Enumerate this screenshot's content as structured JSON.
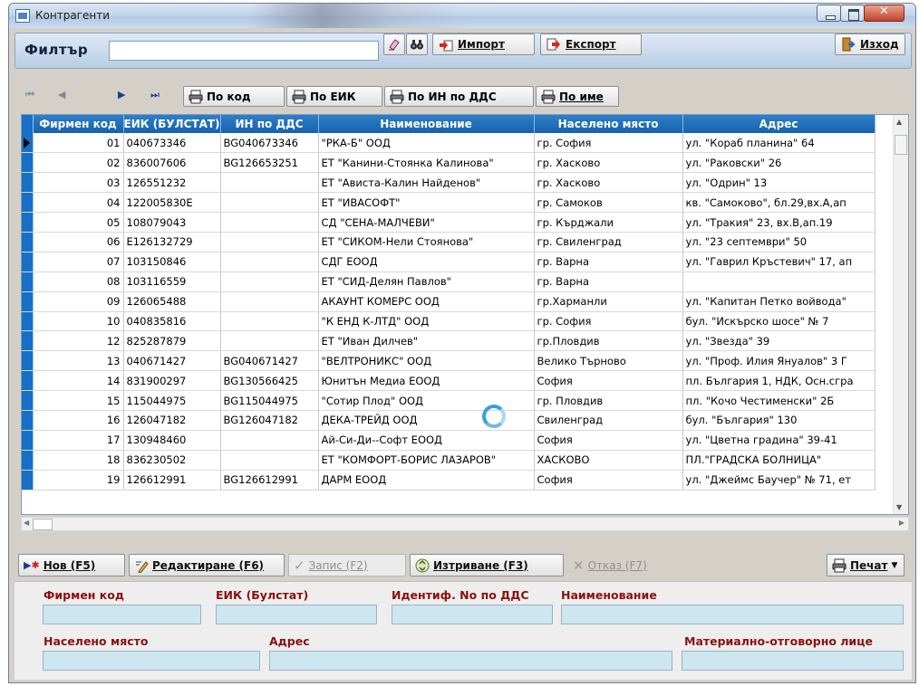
{
  "window": {
    "title": "Контрагенти"
  },
  "filter": {
    "label": "Филтър",
    "value": "",
    "import_label": "Импорт",
    "export_label": "Експорт",
    "exit_label": "Изход"
  },
  "navigation": {
    "sort_by_code": "По код",
    "sort_by_eik": "По ЕИК",
    "sort_by_vat": "По ИН по ДДС",
    "sort_by_name": "По име"
  },
  "grid": {
    "columns": [
      "Фирмен код",
      "ЕИК (БУЛСТАТ)",
      "ИН по ДДС",
      "Наименование",
      "Населено място",
      "Адрес"
    ],
    "rows": [
      [
        "01",
        "040673346",
        "BG040673346",
        "\"РКА-Б\" ООД",
        "гр. София",
        "ул. \"Кораб планина\" 64"
      ],
      [
        "02",
        "836007606",
        "BG126653251",
        "ЕТ \"Канини-Стоянка Калинова\"",
        "гр. Хасково",
        "ул. \"Раковски\" 26"
      ],
      [
        "03",
        "126551232",
        "",
        "ЕТ \"Ависта-Калин Найденов\"",
        "гр. Хасково",
        "ул. \"Одрин\" 13"
      ],
      [
        "04",
        "122005830Е",
        "",
        "ЕТ \"ИВАСОФТ\"",
        "гр. Самоков",
        "кв. \"Самоково\", бл.29,вх.А,ап"
      ],
      [
        "05",
        "108079043",
        "",
        "СД \"СЕНА-МАЛЧЕВИ\"",
        "гр. Кърджали",
        "ул. \"Тракия\" 23, вх.В,ап.19"
      ],
      [
        "06",
        "Е126132729",
        "",
        "ЕТ \"СИКОМ-Нели Стоянова\"",
        "гр. Свиленград",
        "ул. \"23 септември\" 50"
      ],
      [
        "07",
        "103150846",
        "",
        "СДГ ЕООД",
        "гр. Варна",
        "ул. \"Гаврил Кръстевич\" 17, ап"
      ],
      [
        "08",
        "103116559",
        "",
        "ЕТ \"СИД-Делян Павлов\"",
        "гр. Варна",
        ""
      ],
      [
        "09",
        "126065488",
        "",
        "АКАУНТ КОМЕРС ООД",
        "гр.Харманли",
        "ул. \"Капитан Петко войвода\""
      ],
      [
        "10",
        "040835816",
        "",
        "\"К ЕНД К-ЛТД\" ООД",
        "гр. София",
        "бул. \"Искърско шосе\" № 7"
      ],
      [
        "12",
        "825287879",
        "",
        "ЕТ \"Иван Дилчев\"",
        "гр.Пловдив",
        "ул. \"Звезда\" 39"
      ],
      [
        "13",
        "040671427",
        "BG040671427",
        "\"ВЕЛТРОНИКС\" ООД",
        "Велико Търново",
        "ул. \"Проф. Илия Януалов\" 3 Г"
      ],
      [
        "14",
        "831900297",
        "BG130566425",
        "Юнитън Медиа ЕООД",
        "София",
        "пл. България 1, НДК, Осн.сгра"
      ],
      [
        "15",
        "115044975",
        "BG115044975",
        "\"Сотир Плод\" ООД",
        "гр. Пловдив",
        "пл. \"Кочо Честименски\" 2Б"
      ],
      [
        "16",
        "126047182",
        "BG126047182",
        "ДЕКА-ТРЕЙД ООД",
        "Свиленград",
        "бул. \"България\" 130"
      ],
      [
        "17",
        "130948460",
        "",
        "Ай-Си-Ди--Софт ЕООД",
        "София",
        "ул. \"Цветна градина\" 39-41"
      ],
      [
        "18",
        "836230502",
        "",
        "ЕТ \"КОМФОРТ-БОРИС ЛАЗАРОВ\"",
        "ХАСКОВО",
        "ПЛ.\"ГРАДСКА БОЛНИЦА\""
      ],
      [
        "19",
        "126612991",
        "BG126612991",
        "ДАРМ ЕООД",
        "София",
        "ул. \"Джеймс Баучер\" № 71, ет"
      ]
    ]
  },
  "actions": {
    "new_label": "Нов (F5)",
    "edit_label": "Редактиране (F6)",
    "save_label": "Запис (F2)",
    "delete_label": "Изтриване (F3)",
    "cancel_label": "Отказ (F7)",
    "print_label": "Печат"
  },
  "form": {
    "company_code_label": "Фирмен код",
    "eik_label": "ЕИК (Булстат)",
    "vat_label": "Идентиф. No по ДДС",
    "name_label": "Наименование",
    "city_label": "Населено място",
    "address_label": "Адрес",
    "mol_label": "Материално-отговорно лице"
  },
  "colors": {
    "header_blue": "#1762ad",
    "label_red": "#8b1010",
    "field_bg": "#cde6ef"
  }
}
